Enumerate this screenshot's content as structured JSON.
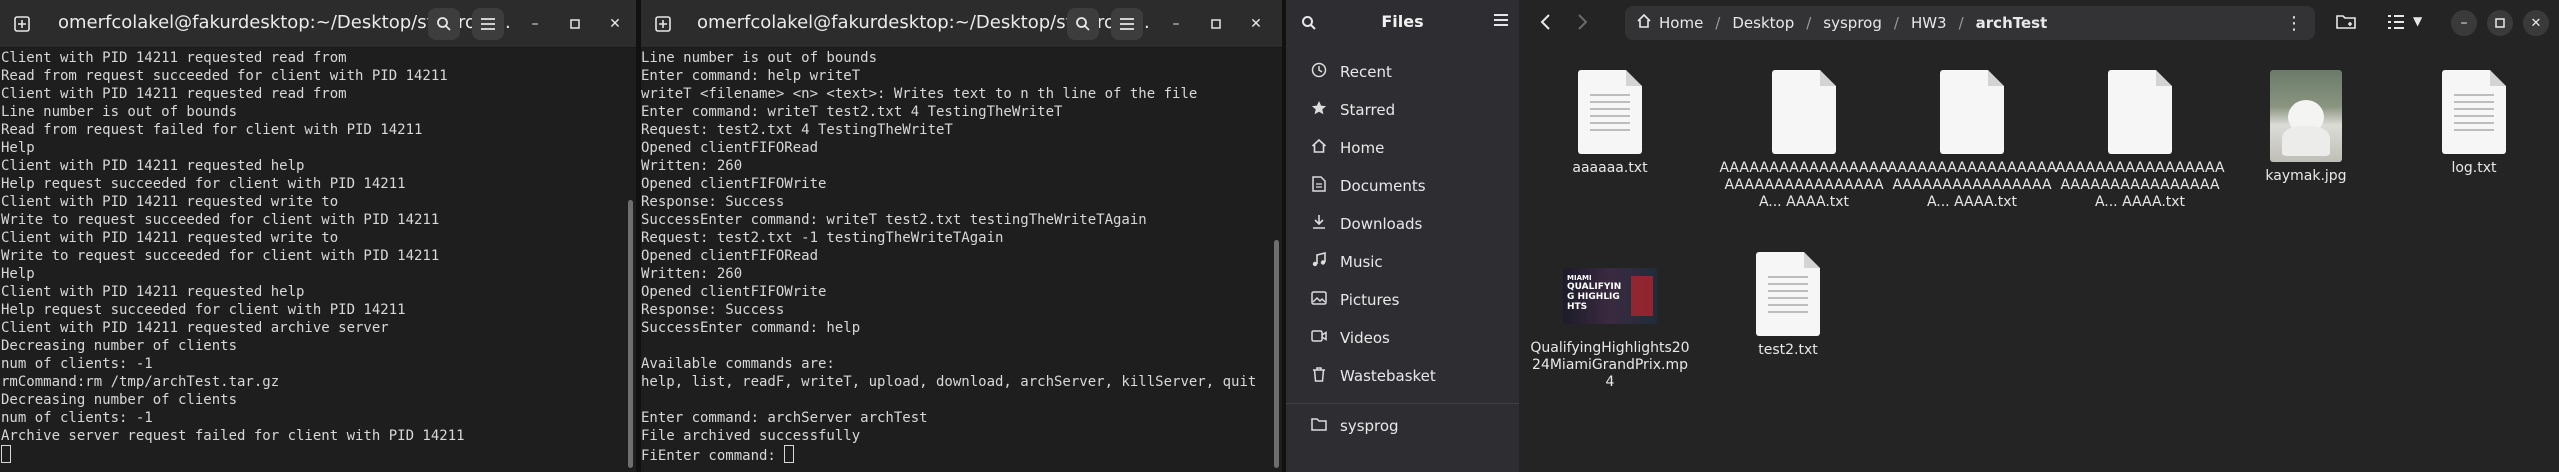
{
  "terminal1": {
    "title": "omerfcolakel@fakurdesktop:~/Desktop/sysprog/...",
    "lines": [
      "Client with PID 14211 requested read from",
      "Read from request succeeded for client with PID 14211",
      "Client with PID 14211 requested read from",
      "Line number is out of bounds",
      "Read from request failed for client with PID 14211",
      "Help",
      "Client with PID 14211 requested help",
      "Help request succeeded for client with PID 14211",
      "Client with PID 14211 requested write to",
      "Write to request succeeded for client with PID 14211",
      "Client with PID 14211 requested write to",
      "Write to request succeeded for client with PID 14211",
      "Help",
      "Client with PID 14211 requested help",
      "Help request succeeded for client with PID 14211",
      "Client with PID 14211 requested archive server",
      "Decreasing number of clients",
      "num of clients: -1",
      "rmCommand:rm /tmp/archTest.tar.gz",
      "Decreasing number of clients",
      "num of clients: -1",
      "Archive server request failed for client with PID 14211"
    ]
  },
  "terminal2": {
    "title": "omerfcolakel@fakurdesktop:~/Desktop/sysprog/...",
    "lines": [
      "Line number is out of bounds",
      "Enter command: help writeT",
      "writeT <filename> <n> <text>: Writes text to n th line of the file",
      "Enter command: writeT test2.txt 4 TestingTheWriteT",
      "Request: test2.txt 4 TestingTheWriteT",
      "Opened clientFIFORead",
      "Written: 260",
      "Opened clientFIFOWrite",
      "Response: Success",
      "SuccessEnter command: writeT test2.txt testingTheWriteTAgain",
      "Request: test2.txt -1 testingTheWriteTAgain",
      "Opened clientFIFORead",
      "Written: 260",
      "Opened clientFIFOWrite",
      "Response: Success",
      "SuccessEnter command: help",
      "",
      "Available commands are:",
      "help, list, readF, writeT, upload, download, archServer, killServer, quit",
      "",
      "Enter command: archServer archTest",
      "File archived successfully",
      "FiEnter command: "
    ]
  },
  "files": {
    "sidebar_title": "Files",
    "nav": [
      {
        "label": "Recent",
        "icon": "clock-icon"
      },
      {
        "label": "Starred",
        "icon": "star-icon"
      },
      {
        "label": "Home",
        "icon": "home-icon"
      },
      {
        "label": "Documents",
        "icon": "document-icon"
      },
      {
        "label": "Downloads",
        "icon": "download-icon"
      },
      {
        "label": "Music",
        "icon": "music-icon"
      },
      {
        "label": "Pictures",
        "icon": "picture-icon"
      },
      {
        "label": "Videos",
        "icon": "video-icon"
      },
      {
        "label": "Wastebasket",
        "icon": "trash-icon"
      },
      {
        "label": "sysprog",
        "icon": "folder-icon"
      }
    ],
    "breadcrumb": [
      "Home",
      "Desktop",
      "sysprog",
      "HW3",
      "archTest"
    ],
    "items": [
      {
        "name": "aaaaaa.txt",
        "type": "text"
      },
      {
        "name": "AAAAAAAAAAAAAAAAAAAAAAAAAAAAAAAAAA... AAAA.txt",
        "type": "text"
      },
      {
        "name": "AAAAAAAAAAAAAAAAAAAAAAAAAAAAAAAAAA... AAAA.txt",
        "type": "text"
      },
      {
        "name": "AAAAAAAAAAAAAAAAAAAAAAAAAAAAAAAAAA... AAAA.txt",
        "type": "text"
      },
      {
        "name": "kaymak.jpg",
        "type": "image"
      },
      {
        "name": "log.txt",
        "type": "text"
      },
      {
        "name": "QualifyingHighlights2024MiamiGrandPrix.mp4",
        "type": "video"
      },
      {
        "name": "test2.txt",
        "type": "text"
      }
    ],
    "video_thumb_text": "QUALIFYING HIGHLIGHTS",
    "video_thumb_label": "MIAMI"
  }
}
